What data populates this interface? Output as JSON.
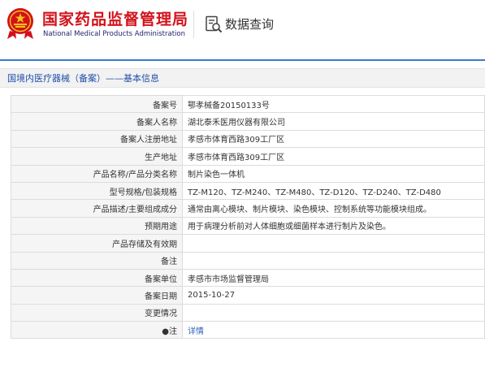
{
  "header": {
    "agency_cn": "国家药品监督管理局",
    "agency_en": "National Medical Products Administration",
    "query_title": "数据查询",
    "emblem_icon": "national-emblem-icon",
    "query_icon": "document-search-icon"
  },
  "breadcrumb": "国境内医疗器械（备案）——基本信息",
  "colors": {
    "brand_red": "#d2121b",
    "link_blue": "#2a62b6",
    "accent_blue": "#3b7bc4"
  },
  "rows": [
    {
      "label": "备案号",
      "value": "鄂孝械备20150133号"
    },
    {
      "label": "备案人名称",
      "value": "湖北泰禾医用仪器有限公司"
    },
    {
      "label": "备案人注册地址",
      "value": "孝感市体育西路309工厂区"
    },
    {
      "label": "生产地址",
      "value": "孝感市体育西路309工厂区"
    },
    {
      "label": "产品名称/产品分类名称",
      "value": "制片染色一体机"
    },
    {
      "label": "型号规格/包装规格",
      "value": "TZ-M120、TZ-M240、TZ-M480、TZ-D120、TZ-D240、TZ-D480"
    },
    {
      "label": "产品描述/主要组成成分",
      "value": "通常由离心模块、制片模块、染色模块、控制系统等功能模块组成。"
    },
    {
      "label": "预期用途",
      "value": "用于病理分析前对人体细胞或细菌样本进行制片及染色。"
    },
    {
      "label": "产品存储及有效期",
      "value": ""
    },
    {
      "label": "备注",
      "value": ""
    },
    {
      "label": "备案单位",
      "value": "孝感市市场监督管理局"
    },
    {
      "label": "备案日期",
      "value": "2015-10-27"
    },
    {
      "label": "变更情况",
      "value": ""
    },
    {
      "label": "●注",
      "value": "详情"
    }
  ]
}
